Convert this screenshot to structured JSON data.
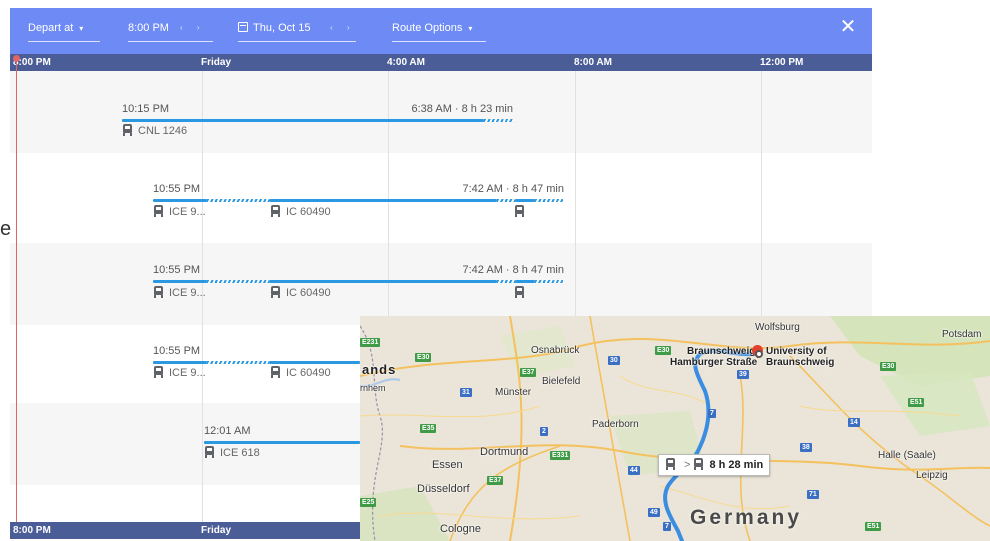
{
  "toolbar": {
    "depart_label": "Depart at",
    "time_value": "8:00 PM",
    "date_value": "Thu, Oct 15",
    "route_options_label": "Route Options",
    "time_arrows": "‹ ›",
    "date_arrows": "‹ ›",
    "close_glyph": "✕",
    "caret_glyph": "▾"
  },
  "timeline": {
    "ticks": [
      "8:00 PM",
      "Friday",
      "4:00 AM",
      "8:00 AM",
      "12:00 PM"
    ],
    "bottom_ticks": [
      "8:00 PM",
      "Friday"
    ]
  },
  "routes": [
    {
      "depart": "10:15 PM",
      "arrive_duration": "6:38 AM · 8 h 23 min",
      "segments": [
        "CNL 1246"
      ]
    },
    {
      "depart": "10:55 PM",
      "arrive_duration": "7:42 AM · 8 h 47 min",
      "segments": [
        "ICE 9...",
        "IC 60490"
      ]
    },
    {
      "depart": "10:55 PM",
      "arrive_duration": "7:42 AM · 8 h 47 min",
      "segments": [
        "ICE 9...",
        "IC 60490"
      ]
    },
    {
      "depart": "10:55 PM",
      "arrive_duration": "",
      "segments": [
        "ICE 9...",
        "IC 60490"
      ]
    },
    {
      "depart": "12:01 AM",
      "arrive_duration": "",
      "segments": [
        "ICE 618"
      ]
    }
  ],
  "edge_text": "e",
  "map": {
    "cities": {
      "wolfsburg": "Wolfsburg",
      "potsdam": "Potsdam",
      "braunschweig": "Braunschweig",
      "hamburger_strasse": "Hamburger Straße",
      "university": "University of",
      "university2": "Braunschweig",
      "osnabruck": "Osnabrück",
      "bielefeld": "Bielefeld",
      "munster": "Münster",
      "paderborn": "Paderborn",
      "dortmund": "Dortmund",
      "essen": "Essen",
      "dusseldorf": "Düsseldorf",
      "cologne": "Cologne",
      "halle": "Halle (Saale)",
      "leipzig": "Leipzig",
      "lands": "ands",
      "rnhem": "rnhem"
    },
    "country": "Germany",
    "badge_duration": "8 h 28 min",
    "badge_gt": ">",
    "shields": {
      "e231": "E231",
      "e30": "E30",
      "e37": "E37",
      "e30b": "E30",
      "a30": "30",
      "a31": "31",
      "a2": "2",
      "e331": "E331",
      "a7": "7",
      "e35": "E35",
      "e37b": "E37",
      "a44": "44",
      "e30c": "E30",
      "e51": "E51",
      "a14": "14",
      "a38": "38",
      "a71": "71",
      "e51b": "E51",
      "a49": "49",
      "a7b": "7",
      "e25": "E25",
      "a39": "39"
    }
  },
  "colors": {
    "toolbar_bg": "#6d8af5",
    "timebar_bg": "#4b5d96",
    "route_blue": "#2b98e2",
    "now_line": "#e06666"
  }
}
